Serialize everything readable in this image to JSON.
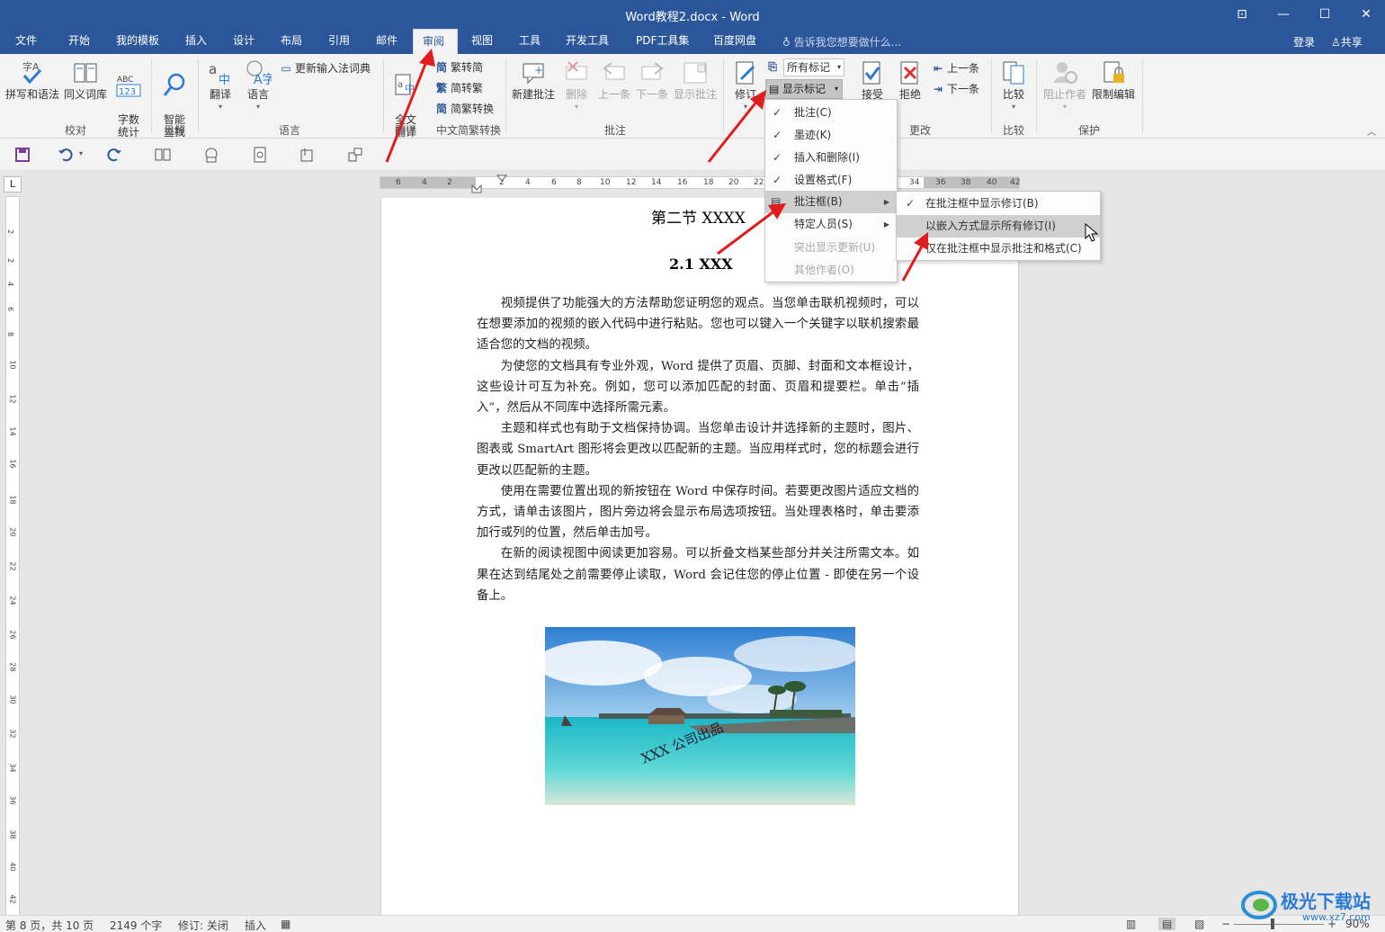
{
  "window": {
    "title": "Word教程2.docx - Word"
  },
  "tabs": [
    "文件",
    "开始",
    "我的模板",
    "插入",
    "设计",
    "布局",
    "引用",
    "邮件",
    "审阅",
    "视图",
    "工具",
    "开发工具",
    "PDF工具集",
    "百度网盘"
  ],
  "active_tab": "审阅",
  "tell_me": "告诉我您想要做什么...",
  "account": {
    "login": "登录",
    "share": "共享"
  },
  "ribbon": {
    "proofing": {
      "spell": "拼写和语法",
      "thesaurus": "同义词库",
      "wordcount": "字数\n统计",
      "label": "校对"
    },
    "insights": {
      "smart_lookup": "智能\n查找",
      "label": "见解"
    },
    "language": {
      "translate": "翻译",
      "language": "语言",
      "update_ime": "更新输入法词典",
      "label": "语言"
    },
    "translate_group": {
      "full_text": "全文\n翻译",
      "label": "翻译"
    },
    "chinese": {
      "t2s": "繁转简",
      "s2t": "简转繁",
      "convert": "简繁转换",
      "label": "中文简繁转换"
    },
    "comments": {
      "new": "新建批注",
      "delete": "删除",
      "prev": "上一条",
      "next": "下一条",
      "show": "显示批注",
      "label": "批注"
    },
    "tracking": {
      "track": "修订",
      "all_markup": "所有标记",
      "show_markup": "显示标记"
    },
    "changes": {
      "accept": "接受",
      "reject": "拒绝",
      "prev": "上一条",
      "next": "下一条",
      "label": "更改"
    },
    "compare": {
      "compare": "比较",
      "label": "比较"
    },
    "protect": {
      "block": "阻止作者",
      "restrict": "限制编辑",
      "label": "保护"
    }
  },
  "show_markup_menu": [
    {
      "label": "批注(C)",
      "checked": true
    },
    {
      "label": "墨迹(K)",
      "checked": true
    },
    {
      "label": "插入和删除(I)",
      "checked": true
    },
    {
      "label": "设置格式(F)",
      "checked": true
    },
    {
      "label": "批注框(B)",
      "submenu": true
    },
    {
      "label": "特定人员(S)",
      "submenu": true
    },
    {
      "label": "突出显示更新(U)",
      "disabled": true
    },
    {
      "label": "其他作者(O)",
      "disabled": true
    }
  ],
  "balloons_submenu": [
    {
      "label": "在批注框中显示修订(B)",
      "checked": true
    },
    {
      "label": "以嵌入方式显示所有修订(I)"
    },
    {
      "label": "仅在批注框中显示批注和格式(C)"
    }
  ],
  "ruler": {
    "h": [
      "6",
      "4",
      "2",
      "2",
      "4",
      "6",
      "8",
      "10",
      "12",
      "14",
      "16",
      "18",
      "20",
      "22",
      "34",
      "36",
      "38",
      "40",
      "42"
    ],
    "v": [
      "2",
      "2",
      "4",
      "6",
      "8",
      "10",
      "12",
      "14",
      "16",
      "18",
      "20",
      "22",
      "24",
      "26",
      "28",
      "30",
      "32",
      "34",
      "36",
      "38",
      "40",
      "42"
    ]
  },
  "document": {
    "heading1": "第二节  XXXX",
    "heading2": "2.1 XXX",
    "paragraphs": [
      "视频提供了功能强大的方法帮助您证明您的观点。当您单击联机视频时，可以在想要添加的视频的嵌入代码中进行粘贴。您也可以键入一个关键字以联机搜索最适合您的文档的视频。",
      "为使您的文档具有专业外观，Word 提供了页眉、页脚、封面和文本框设计，这些设计可互为补充。例如，您可以添加匹配的封面、页眉和提要栏。单击“插入”，然后从不同库中选择所需元素。",
      "主题和样式也有助于文档保持协调。当您单击设计并选择新的主题时，图片、图表或 SmartArt 图形将会更改以匹配新的主题。当应用样式时，您的标题会进行更改以匹配新的主题。",
      "使用在需要位置出现的新按钮在 Word 中保存时间。若要更改图片适应文档的方式，请单击该图片，图片旁边将会显示布局选项按钮。当处理表格时，单击要添加行或列的位置，然后单击加号。",
      "在新的阅读视图中阅读更加容易。可以折叠文档某些部分并关注所需文本。如果在达到结尾处之前需要停止读取，Word 会记住您的停止位置 - 即使在另一个设备上。"
    ],
    "image_caption": "XXX 公司出品"
  },
  "status": {
    "page": "第 8 页，共 10 页",
    "words": "2149 个字",
    "track": "修订: 关闭",
    "insert": "插入",
    "zoom": "90%"
  },
  "watermark": {
    "name": "极光下载站",
    "url": "www.xz7.com"
  },
  "colors": {
    "title_bar": "#2b579a",
    "arrow": "#e11c1c",
    "ribbon": "#f3f3f3"
  }
}
